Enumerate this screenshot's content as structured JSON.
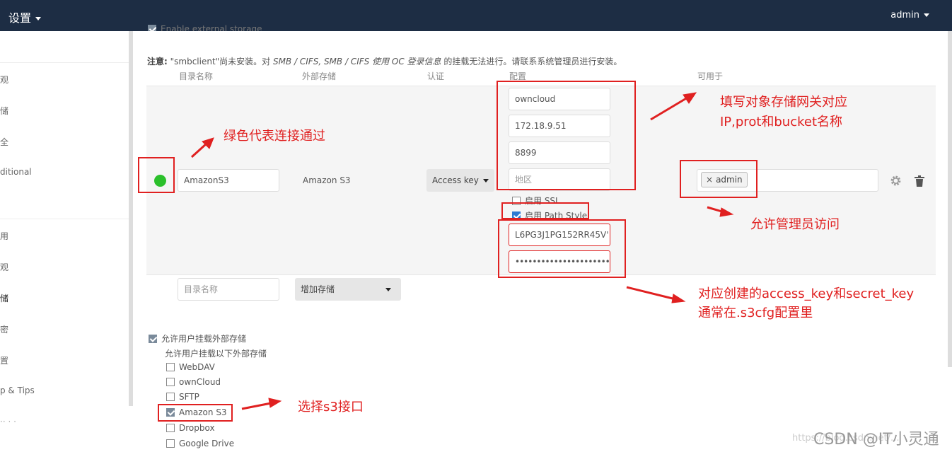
{
  "topbar": {
    "settings": "设置",
    "user": "admin"
  },
  "sidebar": {
    "items": [
      "观",
      "储",
      "全",
      "ditional",
      "用",
      "观",
      "储",
      "密",
      "置",
      "p & Tips",
      "·· · ·"
    ]
  },
  "enable_external": "Enable external storage",
  "notice": {
    "label": "注意:",
    "text": " \"smbclient\"尚未安装。对 ",
    "italic": "SMB / CIFS, SMB / CIFS 使用 OC 登录信息",
    "rest": " 的挂载无法进行。请联系系统管理员进行安装。"
  },
  "table_headers": {
    "folder": "目录名称",
    "storage": "外部存储",
    "auth": "认证",
    "config": "配置",
    "available": "可用于"
  },
  "mount": {
    "folder": "AmazonS3",
    "storage": "Amazon S3",
    "auth": "Access key",
    "bucket": "owncloud",
    "host": "172.18.9.51",
    "port": "8899",
    "region_placeholder": "地区",
    "ssl_label": "启用 SSL",
    "pathstyle_label": "启用 Path Style",
    "access_key": "L6PG3J1PG152RR45V'",
    "secret_key": "••••••••••••••••••••••••••••",
    "applicable_tag": "admin",
    "status_color": "#2bc02b"
  },
  "new_mount": {
    "folder_placeholder": "目录名称",
    "add_storage": "增加存储"
  },
  "user_mounting": {
    "allow_label": "允许用户挂载外部存储",
    "sub_label": "允许用户挂载以下外部存储",
    "backends": [
      {
        "label": "WebDAV",
        "checked": false
      },
      {
        "label": "ownCloud",
        "checked": false
      },
      {
        "label": "SFTP",
        "checked": false
      },
      {
        "label": "Amazon S3",
        "checked": true
      },
      {
        "label": "Dropbox",
        "checked": false
      },
      {
        "label": "Google Drive",
        "checked": false
      }
    ]
  },
  "annotations": {
    "green": "绿色代表连接通过",
    "fill1": "填写对象存储网关对应",
    "fill2": "IP,prot和bucket名称",
    "admin": "允许管理员访问",
    "keys1": "对应创建的access_key和secret_key",
    "keys2": "通常在.s3cfg配置里",
    "s3": "选择s3接口"
  },
  "watermark": {
    "url": "https://blog.csdn.net/...",
    "brand": "CSDN @IT小灵通"
  },
  "colors": {
    "annotation": "#e02020",
    "topbar": "#1d2d44",
    "success": "#2bc02b"
  }
}
